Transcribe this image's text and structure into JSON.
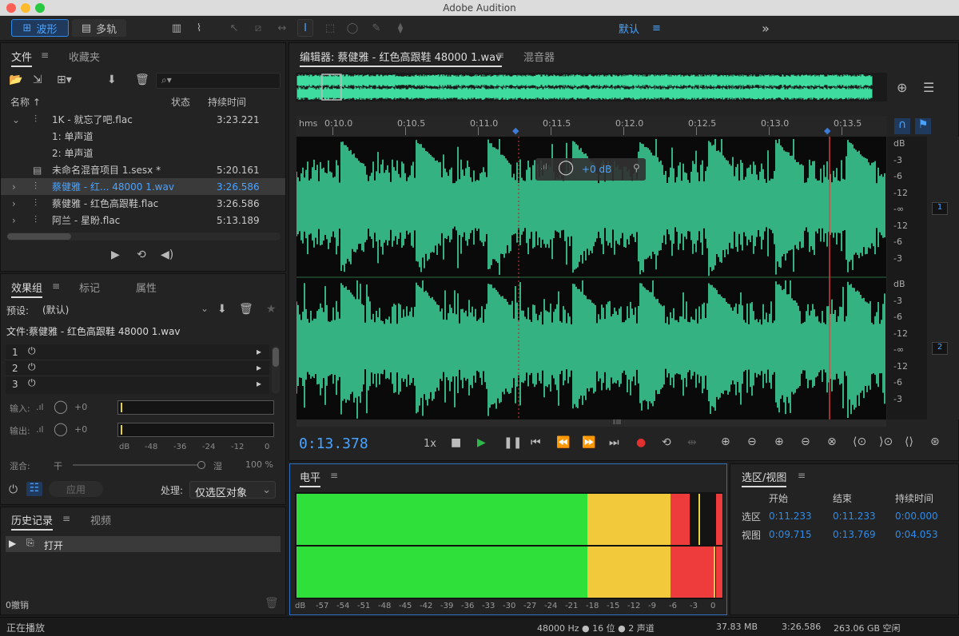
{
  "window": {
    "title": "Adobe Audition"
  },
  "toolbar": {
    "waveform_label": "波形",
    "multitrack_label": "多轨",
    "workspace_label": "默认",
    "more_label": "»"
  },
  "files_panel": {
    "tab_files": "文件",
    "tab_favorites": "收藏夹",
    "columns": {
      "name": "名称",
      "status": "状态",
      "duration": "持续时间"
    },
    "rows": [
      {
        "name": "1K - 就忘了吧.flac",
        "duration": "3:23.221"
      },
      {
        "name": "1: 单声道",
        "duration": ""
      },
      {
        "name": "2: 单声道",
        "duration": ""
      },
      {
        "name": "未命名混音项目 1.sesx *",
        "duration": "5:20.161"
      },
      {
        "name": "蔡健雅 - 红... 48000 1.wav",
        "duration": "3:26.586"
      },
      {
        "name": "蔡健雅 - 红色高跟鞋.flac",
        "duration": "3:26.586"
      },
      {
        "name": "阿兰 - 星盼.flac",
        "duration": "5:13.189"
      }
    ]
  },
  "effects_panel": {
    "tab_effects": "效果组",
    "tab_markers": "标记",
    "tab_properties": "属性",
    "preset_label": "预设:",
    "preset_value": "(默认)",
    "file_label": "文件:蔡健雅 - 红色高跟鞋 48000 1.wav",
    "slots": [
      "1",
      "2",
      "3"
    ],
    "input_label": "输入:",
    "output_label": "输出:",
    "input_value": "+0",
    "output_value": "+0",
    "meter_scale": [
      "dB",
      "-48",
      "-36",
      "-24",
      "-12",
      "0"
    ],
    "mix_label": "混合:",
    "dry_label": "干",
    "wet_label": "湿",
    "mix_value": "100 %",
    "apply_label": "应用",
    "process_label": "处理:",
    "process_value": "仅选区对象"
  },
  "history_panel": {
    "tab_history": "历史记录",
    "tab_video": "视频",
    "item": "打开",
    "undo_label": "0撤销"
  },
  "editor": {
    "tab_editor": "编辑器: 蔡健雅 - 红色高跟鞋 48000 1.wav",
    "tab_mixer": "混音器",
    "ruler_unit": "hms",
    "ruler_ticks": [
      "0:10.0",
      "0:10.5",
      "0:11.0",
      "0:11.5",
      "0:12.0",
      "0:12.5",
      "0:13.0",
      "0:13.5"
    ],
    "db_scale_top": [
      "dB",
      "-3",
      "-6",
      "-12",
      "-∞",
      "-12",
      "-6",
      "-3"
    ],
    "db_scale_bottom": [
      "dB",
      "-3",
      "-6",
      "-12",
      "-∞",
      "-12",
      "-6",
      "-3"
    ],
    "channel_1": "1",
    "channel_2": "2",
    "hud_gain": "+0 dB",
    "time_display": "0:13.378",
    "speed": "1x"
  },
  "levels_panel": {
    "title": "电平",
    "scale": [
      "dB",
      "-57",
      "-54",
      "-51",
      "-48",
      "-45",
      "-42",
      "-39",
      "-36",
      "-33",
      "-30",
      "-27",
      "-24",
      "-21",
      "-18",
      "-15",
      "-12",
      "-9",
      "-6",
      "-3",
      "0"
    ]
  },
  "selection_panel": {
    "title": "选区/视图",
    "col_start": "开始",
    "col_end": "结束",
    "col_duration": "持续时间",
    "row_selection": "选区",
    "row_view": "视图",
    "selection": {
      "start": "0:11.233",
      "end": "0:11.233",
      "duration": "0:00.000"
    },
    "view": {
      "start": "0:09.715",
      "end": "0:13.769",
      "duration": "0:04.053"
    }
  },
  "status": {
    "left": "正在播放",
    "format": "48000 Hz ● 16 位 ● 2 声道",
    "size": "37.83 MB",
    "duration": "3:26.586",
    "free": "263.06 GB 空闲"
  },
  "colors": {
    "waveform": "#3fdca0",
    "accent": "#2d8ceb",
    "playhead": "#d83a3a"
  }
}
